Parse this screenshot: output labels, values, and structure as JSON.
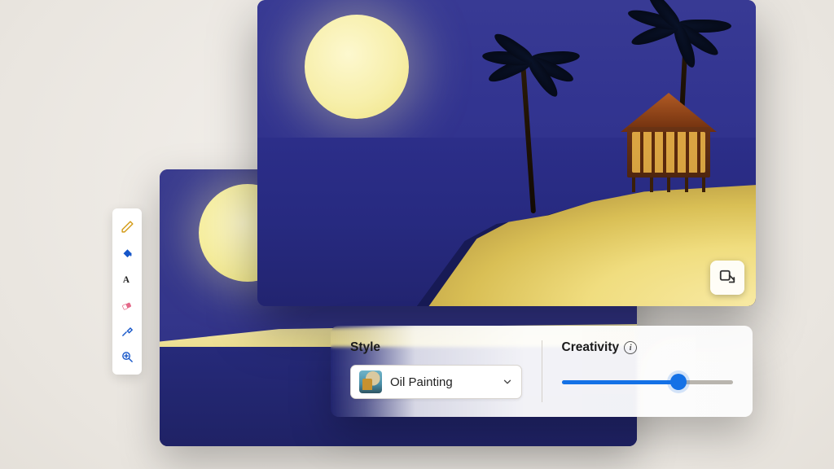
{
  "toolbar": {
    "tools": [
      {
        "name": "pencil-icon",
        "color": "#d39b17"
      },
      {
        "name": "bucket-icon",
        "color": "#1656c9"
      },
      {
        "name": "text-icon",
        "color": "#222222"
      },
      {
        "name": "eraser-icon",
        "color": "#e46a8a"
      },
      {
        "name": "eyedropper-icon",
        "color": "#1656c9"
      },
      {
        "name": "zoom-icon",
        "color": "#1656c9"
      }
    ]
  },
  "front_canvas": {
    "expand_tooltip": "Expand"
  },
  "panel": {
    "style": {
      "heading": "Style",
      "selected": "Oil Painting"
    },
    "creativity": {
      "heading": "Creativity",
      "info_glyph": "i",
      "value_pct": 68
    }
  }
}
